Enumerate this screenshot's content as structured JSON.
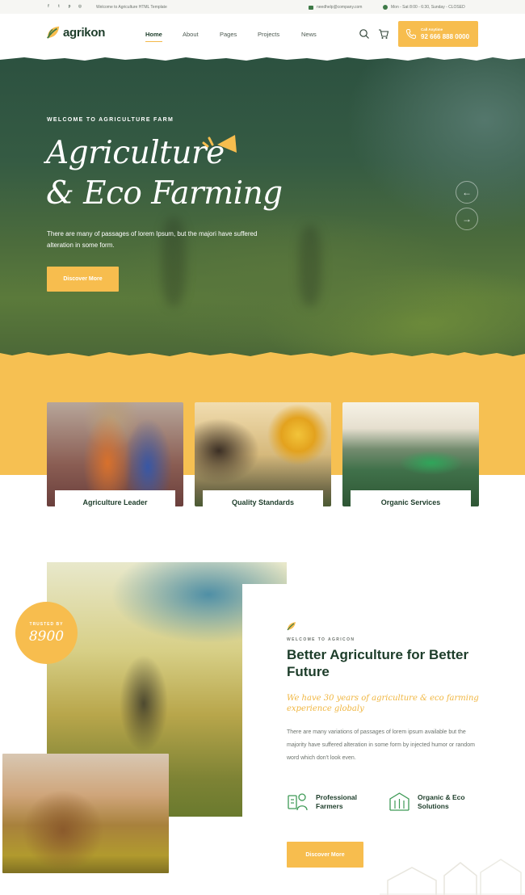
{
  "topbar": {
    "social_icons": [
      "facebook-icon",
      "twitter-icon",
      "pinterest-icon",
      "instagram-icon"
    ],
    "welcome": "Welcome to Agriculture HTML Template",
    "email": "needhelp@company.com",
    "hours": "Mon - Sat 8:00 - 6:30, Sunday - CLOSED"
  },
  "header": {
    "logo": "agrikon",
    "nav": [
      "Home",
      "About",
      "Pages",
      "Projects",
      "News"
    ],
    "call_label": "Call Anytime",
    "call_number": "92 666 888 0000"
  },
  "hero": {
    "eyebrow": "WELCOME TO AGRICULTURE FARM",
    "title_line1": "Agriculture",
    "title_line2": "& Eco Farming",
    "description": "There are many of passages of lorem Ipsum, but the majori have suffered alteration in some form.",
    "button": "Discover More",
    "prev": "←",
    "next": "→"
  },
  "cards": [
    {
      "label": "Agriculture Leader"
    },
    {
      "label": "Quality Standards"
    },
    {
      "label": "Organic Services"
    }
  ],
  "about": {
    "badge_label": "TRUSTED BY",
    "badge_number": "8900",
    "eyebrow": "WELCOME TO AGRICON",
    "title": "Better Agriculture for Better Future",
    "subtitle": "We have 30 years of agriculture & eco farming experience globaly",
    "description": "There are many variations of passages of lorem ipsum available but the majority have suffered alteration in some form by injected humor or random word which don't look even.",
    "features": [
      {
        "label": "Professional Farmers"
      },
      {
        "label": "Organic & Eco Solutions"
      }
    ],
    "button": "Discover More"
  },
  "colors": {
    "accent": "#f7bd4e",
    "brand_green": "#1d3d2a"
  }
}
